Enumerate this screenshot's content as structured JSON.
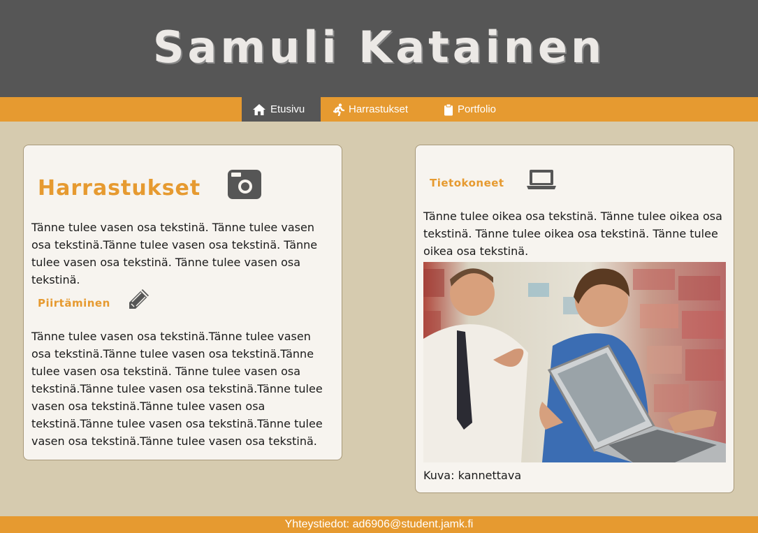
{
  "header": {
    "title": "Samuli Katainen"
  },
  "nav": {
    "items": [
      {
        "label": "Etusivu",
        "icon": "home-icon",
        "active": true
      },
      {
        "label": "Harrastukset",
        "icon": "running-icon",
        "active": false
      },
      {
        "label": "Portfolio",
        "icon": "clipboard-icon",
        "active": false
      }
    ]
  },
  "left": {
    "heading": "Harrastukset",
    "heading_icon": "camera-icon",
    "paragraph1": "Tänne tulee vasen osa tekstinä. Tänne tulee vasen osa tekstinä.Tänne tulee vasen osa tekstinä. Tänne tulee vasen osa tekstinä. Tänne tulee vasen osa tekstinä.",
    "subheading": "Piirtäminen",
    "subheading_icon": "pencil-icon",
    "paragraph2": "Tänne tulee vasen osa tekstinä.Tänne tulee vasen osa tekstinä.Tänne tulee vasen osa tekstinä.Tänne tulee vasen osa tekstinä. Tänne tulee vasen osa tekstinä.Tänne tulee vasen osa tekstinä.Tänne tulee vasen osa tekstinä.Tänne tulee vasen osa tekstinä.Tänne tulee vasen osa tekstinä.Tänne tulee vasen osa tekstinä.Tänne tulee vasen osa tekstinä."
  },
  "right": {
    "heading": "Tietokoneet",
    "heading_icon": "laptop-icon",
    "paragraph": "Tänne tulee oikea osa tekstinä. Tänne tulee oikea osa tekstinä. Tänne tulee oikea osa tekstinä. Tänne tulee oikea osa tekstinä.",
    "caption": "Kuva: kannettava"
  },
  "footer": {
    "text": "Yhteystiedot: ad6906@student.jamk.fi"
  },
  "colors": {
    "accent": "#e69a30",
    "header_bg": "#565656",
    "page_bg": "#d6cbaf",
    "card_bg": "#f7f4ef"
  }
}
